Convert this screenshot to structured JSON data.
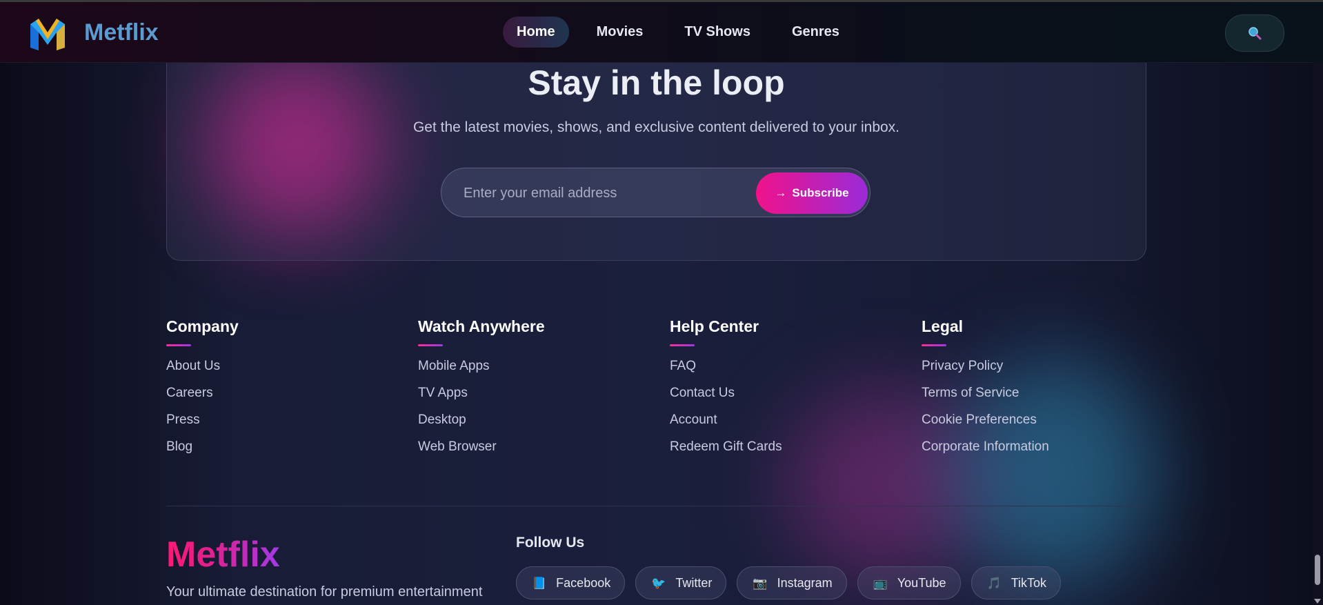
{
  "header": {
    "brand": "Metflix",
    "nav": [
      "Home",
      "Movies",
      "TV Shows",
      "Genres"
    ],
    "active_nav": "Home",
    "search_icon": "search-icon"
  },
  "newsletter": {
    "title": "Stay in the loop",
    "subtitle": "Get the latest movies, shows, and exclusive content delivered to your inbox.",
    "email_placeholder": "Enter your email address",
    "email_value": "",
    "subscribe_arrow": "→",
    "subscribe_label": "Subscribe"
  },
  "footer": {
    "columns": [
      {
        "title": "Company",
        "links": [
          "About Us",
          "Careers",
          "Press",
          "Blog"
        ]
      },
      {
        "title": "Watch Anywhere",
        "links": [
          "Mobile Apps",
          "TV Apps",
          "Desktop",
          "Web Browser"
        ]
      },
      {
        "title": "Help Center",
        "links": [
          "FAQ",
          "Contact Us",
          "Account",
          "Redeem Gift Cards"
        ]
      },
      {
        "title": "Legal",
        "links": [
          "Privacy Policy",
          "Terms of Service",
          "Cookie Preferences",
          "Corporate Information"
        ]
      }
    ],
    "brand": "Metflix",
    "tagline": "Your ultimate destination for premium entertainment",
    "follow_title": "Follow Us",
    "socials": [
      {
        "label": "Facebook",
        "icon": "📘"
      },
      {
        "label": "Twitter",
        "icon": "🐦"
      },
      {
        "label": "Instagram",
        "icon": "📷"
      },
      {
        "label": "YouTube",
        "icon": "📺"
      },
      {
        "label": "TikTok",
        "icon": "🎵"
      }
    ]
  },
  "colors": {
    "accent_pink": "#f0128a",
    "accent_purple": "#9a2bd8",
    "brand_blue": "#5b9bd0",
    "background": "#111328"
  }
}
